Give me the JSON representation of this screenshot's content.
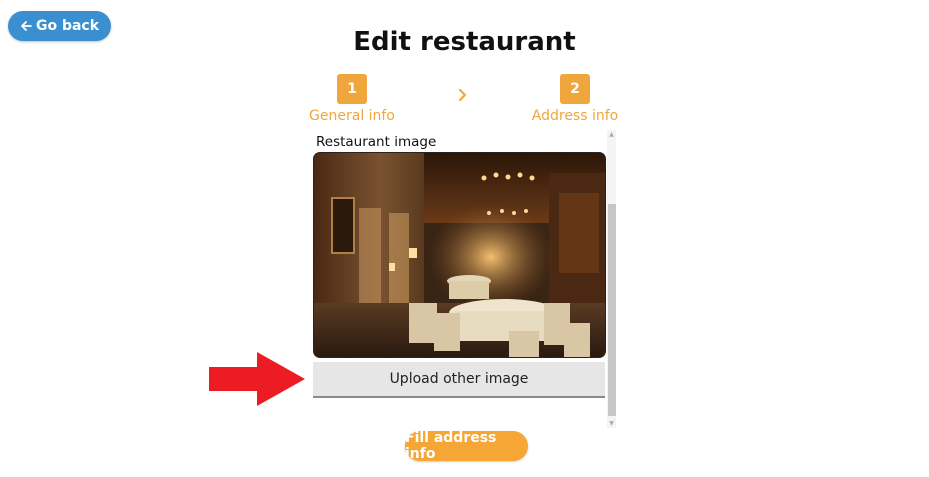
{
  "nav": {
    "back_label": "Go back",
    "back_icon": "arrow-left-icon"
  },
  "page": {
    "title": "Edit restaurant"
  },
  "stepper": {
    "steps": [
      {
        "number": "1",
        "label": "General info"
      },
      {
        "number": "2",
        "label": "Address info"
      }
    ],
    "separator_icon": "chevron-right-icon",
    "accent_color": "#f0a63c"
  },
  "image_section": {
    "label": "Restaurant image",
    "upload_button_label": "Upload other image"
  },
  "footer": {
    "next_button_label": "Fill address info"
  },
  "colors": {
    "back_button": "#3a8fd0",
    "next_button": "#f5a634",
    "annotation_arrow": "#ed1c24"
  }
}
